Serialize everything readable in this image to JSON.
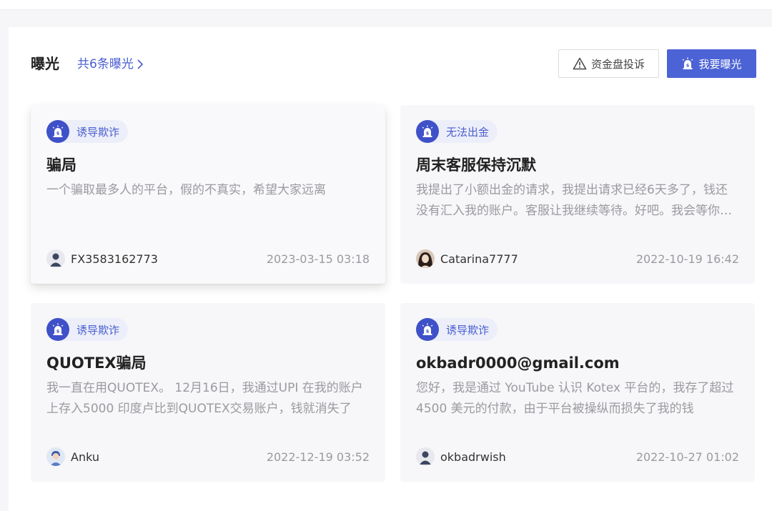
{
  "header": {
    "title": "曝光",
    "count_link": "共6条曝光",
    "complaint_button": "资金盘投诉",
    "expose_button": "我要曝光"
  },
  "colors": {
    "accent": "#4c63d6",
    "tag_text": "#4a5fd1",
    "tag_bg": "#eceef9",
    "muted": "#9a9aa0"
  },
  "cards": [
    {
      "tag": "诱导欺诈",
      "title": "骗局",
      "desc": "一个骗取最多人的平台，假的不真实，希望大家远离",
      "user": "FX3583162773",
      "time": "2023-03-15 03:18",
      "avatar_icon": "default-user-icon"
    },
    {
      "tag": "无法出金",
      "title": "周末客服保持沉默",
      "desc": "我提出了小额出金的请求，我提出请求已经6天多了，钱还没有汇入我的账户。客服让我继续等待。好吧。我会等你们的。",
      "user": "Catarina7777",
      "time": "2022-10-19 16:42",
      "avatar_icon": "photo-avatar-icon"
    },
    {
      "tag": "诱导欺诈",
      "title": "QUOTEX骗局",
      "desc": "我一直在用QUOTEX。 12月16日，我通过UPI 在我的账户上存入5000 印度卢比到QUOTEX交易账户，钱就消失了",
      "user": "Anku",
      "time": "2022-12-19 03:52",
      "avatar_icon": "cartoon-avatar-icon"
    },
    {
      "tag": "诱导欺诈",
      "title": "okbadr0000@gmail.com",
      "desc": "您好，我是通过 YouTube 认识 Kotex 平台的，我存了超过 4500 美元的付款，由于平台被操纵而损失了我的钱",
      "user": "okbadrwish",
      "time": "2022-10-27 01:02",
      "avatar_icon": "default-user-icon"
    }
  ]
}
